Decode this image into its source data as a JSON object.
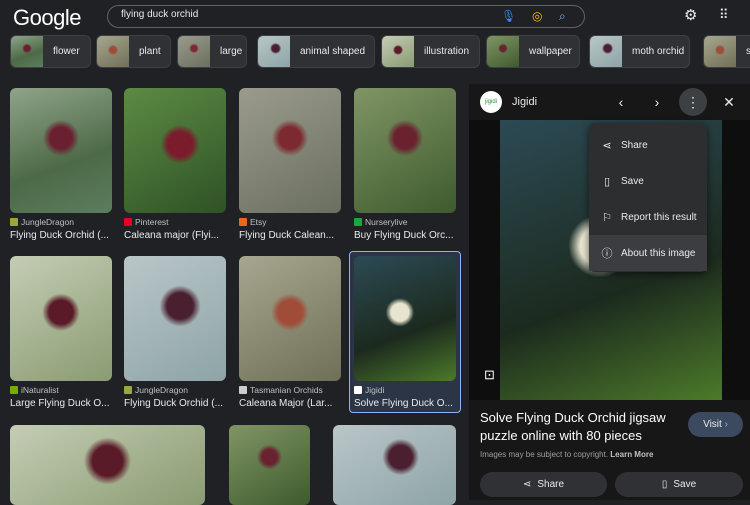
{
  "header": {
    "logo": "Google",
    "search_value": "flying duck orchid",
    "icons": [
      "mic-icon",
      "lens-icon",
      "search-icon",
      "gear-icon",
      "apps-icon"
    ]
  },
  "chips": [
    "flower",
    "plant",
    "large",
    "animal shaped",
    "illustration",
    "wallpaper",
    "moth orchid",
    "se"
  ],
  "results": [
    {
      "source": "JungleDragon",
      "title": "Flying Duck Orchid (...",
      "favicon_color": "#9aa83a"
    },
    {
      "source": "Pinterest",
      "title": "Caleana major (Flyi...",
      "favicon_color": "#e60023"
    },
    {
      "source": "Etsy",
      "title": "Flying Duck Calean...",
      "favicon_color": "#f1641e"
    },
    {
      "source": "Nurserylive",
      "title": "Buy Flying Duck Orc...",
      "favicon_color": "#1aa839"
    },
    {
      "source": "iNaturalist",
      "title": "Large Flying Duck O...",
      "favicon_color": "#74ac00"
    },
    {
      "source": "JungleDragon",
      "title": "Flying Duck Orchid (...",
      "favicon_color": "#9aa83a"
    },
    {
      "source": "Tasmanian Orchids",
      "title": "Caleana Major (Lar...",
      "favicon_color": "#cccccc"
    },
    {
      "source": "Jigidi",
      "title": "Solve Flying Duck O...",
      "favicon_color": "#ffffff"
    }
  ],
  "panel": {
    "site": "Jigidi",
    "menu": [
      {
        "label": "Share",
        "icon": "share-icon"
      },
      {
        "label": "Save",
        "icon": "bookmark-icon"
      },
      {
        "label": "Report this result",
        "icon": "flag-icon"
      },
      {
        "label": "About this image",
        "icon": "info-icon"
      }
    ],
    "title": "Solve Flying Duck Orchid jigsaw puzzle online with 80 pieces",
    "visit": "Visit",
    "copyright": "Images may be subject to copyright.",
    "learn_more": "Learn More",
    "share": "Share",
    "save": "Save"
  },
  "colors": {
    "background": "#202124",
    "accent": "#8ab4f8",
    "selected": "#2c3545"
  }
}
